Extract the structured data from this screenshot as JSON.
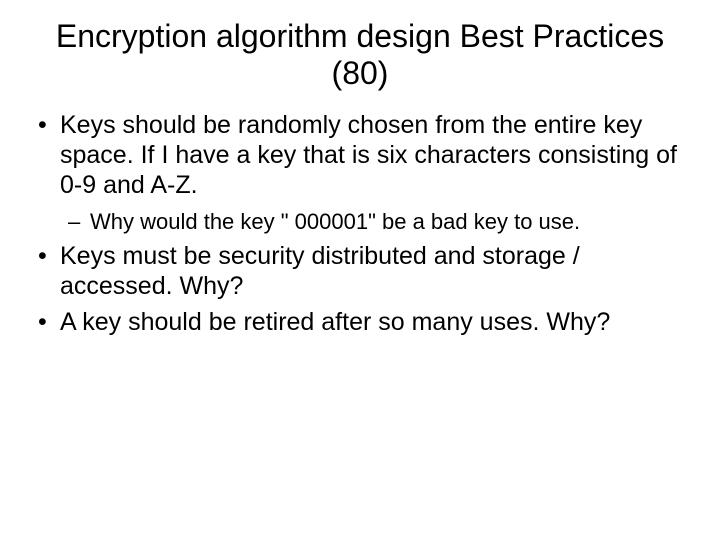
{
  "title": "Encryption algorithm design Best Practices (80)",
  "bullets": [
    {
      "text": "Keys should be randomly chosen from the entire key space. If I have a key that is six characters consisting of 0-9 and A-Z.",
      "sub": [
        "Why would the key \" 000001\" be a bad key to use."
      ]
    },
    {
      "text": "Keys must be security distributed and storage / accessed. Why?",
      "sub": []
    },
    {
      "text": "A key should be retired after so many uses. Why?",
      "sub": []
    }
  ]
}
